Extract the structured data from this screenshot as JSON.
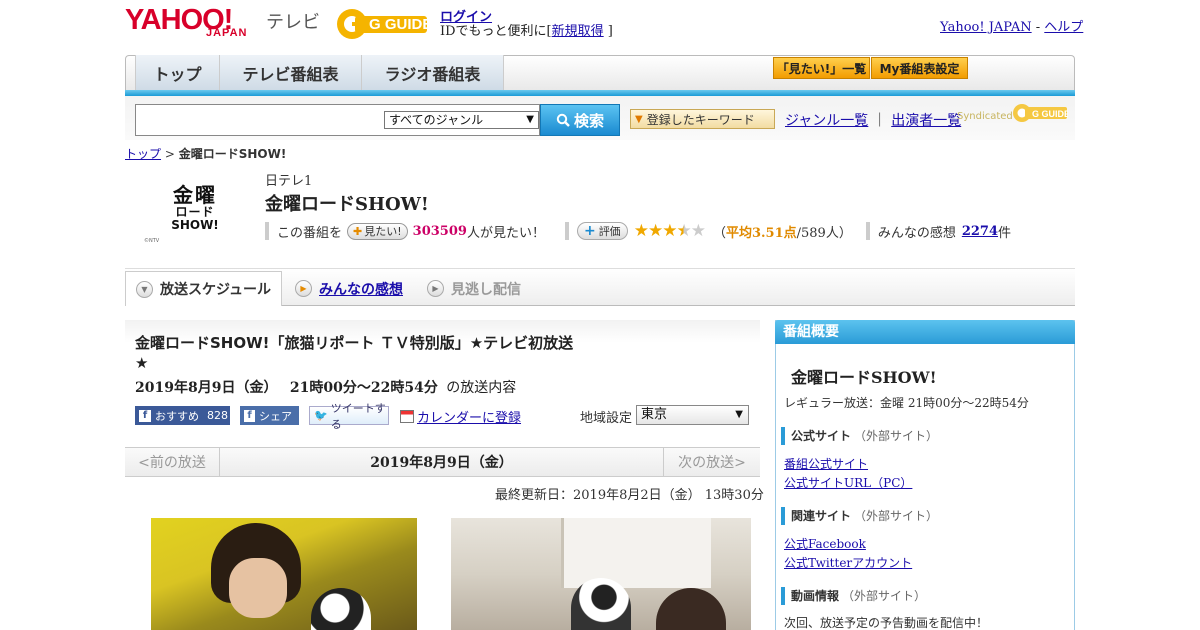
{
  "header": {
    "logo_yahoo": "YAHOO!",
    "logo_japan": "JAPAN",
    "logo_service": "テレビ",
    "gguide_logo": "G GUIDE",
    "login": "ログイン",
    "login_desc": "IDでもっと便利に[",
    "signup": "新規取得",
    "login_close": " ]",
    "yahoo_japan_link": "Yahoo! JAPAN",
    "separator": " - ",
    "help_link": "ヘルプ"
  },
  "nav": {
    "tabs": [
      {
        "label": "トップ"
      },
      {
        "label": "テレビ番組表"
      },
      {
        "label": "ラジオ番組表"
      }
    ],
    "mitai_list": "「見たい!」一覧",
    "my_settings": "My番組表設定"
  },
  "search": {
    "genre_selected": "すべてのジャンル",
    "search_button": "検索",
    "keyword_button": "登録したキーワード",
    "genre_list": "ジャンル一覧",
    "divider": "｜",
    "performer_list": "出演者一覧",
    "syndicated": "Syndicated"
  },
  "breadcrumb": {
    "top": "トップ",
    "sep": " > ",
    "current": "金曜ロードSHOW!"
  },
  "program": {
    "logo_line1": "金曜",
    "logo_line2": "ロード",
    "logo_line3": "SHOW!",
    "logo_credit": "©NTV",
    "channel": "日テレ1",
    "title": "金曜ロードSHOW!",
    "mitai_prefix": "この番組を",
    "mitai_button": "見たい!",
    "mitai_count": "303509",
    "mitai_suffix": "人が見たい！",
    "rating_button": "評価",
    "rating_value": 3.51,
    "rating_open": "（",
    "rating_avg": "平均3.51点",
    "rating_people": "/589人）",
    "reviews_prefix": "みんなの感想",
    "reviews_count": "2274",
    "reviews_suffix": "件"
  },
  "tabs": {
    "schedule": "放送スケジュール",
    "reviews": "みんなの感想",
    "missed": "見逃し配信"
  },
  "episode": {
    "title": "金曜ロードSHOW!「旅猫リポート ＴＶ特別版」★テレビ初放送★",
    "date": "2019年8月9日（金）",
    "time": "21時00分～22時54分",
    "date_suffix": "の放送内容",
    "fb_recommend": "おすすめ",
    "fb_count": "828",
    "fb_share": "シェア",
    "tweet": "ツイートする",
    "calendar": "カレンダーに登録",
    "region_label": "地域設定",
    "region_value": "東京",
    "prev": "<前の放送",
    "current_date": "2019年8月9日（金）",
    "next": "次の放送>",
    "updated": "最終更新日：2019年8月2日（金） 13時30分"
  },
  "sidebar": {
    "header": "番組概要",
    "title": "金曜ロードSHOW!",
    "regular": "レギュラー放送：金曜 21時00分～22時54分",
    "official_head": "公式サイト",
    "external": "（外部サイト）",
    "official_links": [
      "番組公式サイト",
      "公式サイトURL（PC）"
    ],
    "related_head": "関連サイト",
    "related_links": [
      "公式Facebook",
      "公式Twitterアカウント"
    ],
    "video_head": "動画情報",
    "video_text": "次回、放送予定の予告動画を配信中！"
  },
  "colors": {
    "yahoo_red": "#d8002a",
    "accent_blue": "#2a9bd7",
    "gguide_yellow": "#f5b400",
    "link": "#1a0dab",
    "pink_count": "#cc0066",
    "rating_orange": "#e08a00"
  }
}
